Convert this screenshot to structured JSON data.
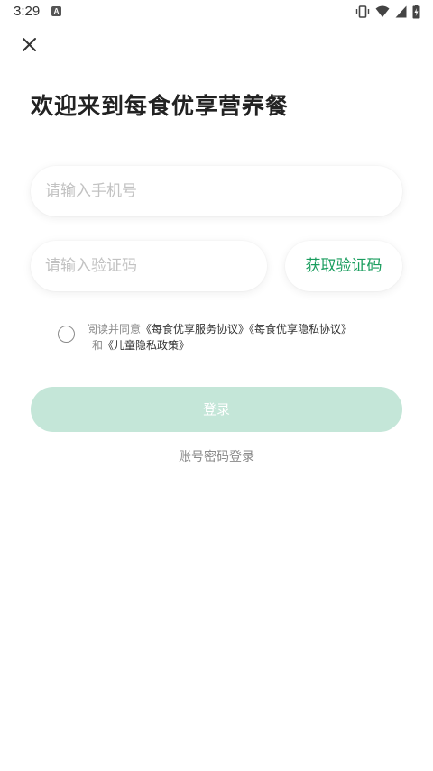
{
  "status_bar": {
    "time": "3:29",
    "notification_icon": "a-icon",
    "icons": [
      "vibrate-icon",
      "wifi-icon",
      "signal-icon",
      "battery-icon"
    ]
  },
  "header": {
    "close_icon": "close-icon",
    "title": "欢迎来到每食优享营养餐"
  },
  "form": {
    "phone": {
      "value": "",
      "placeholder": "请输入手机号"
    },
    "code": {
      "value": "",
      "placeholder": "请输入验证码"
    },
    "get_code_label": "获取验证码"
  },
  "agreement": {
    "checked": false,
    "prefix": "阅读并同意",
    "service_link": "《每食优享服务协议》",
    "privacy_link": "《每食优享隐私协议》",
    "conjunction": "和",
    "children_link": "《儿童隐私政策》"
  },
  "actions": {
    "login_label": "登录",
    "password_login_label": "账号密码登录"
  },
  "colors": {
    "accent": "#1a9d5e",
    "login_disabled_bg": "#c4e6d8",
    "placeholder": "#c2c2c2",
    "secondary_text": "#8a8a8a"
  }
}
